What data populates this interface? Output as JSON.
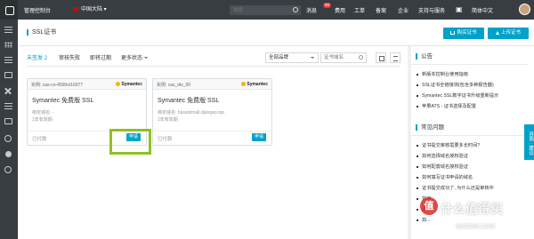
{
  "topbar": {
    "title": "管理控制台",
    "region": "中国大陆",
    "search_placeholder": "搜索",
    "nav": [
      "消息",
      "费用",
      "工单",
      "备案",
      "企业",
      "支持与服务"
    ],
    "message_badge": "88",
    "language": "简体中文"
  },
  "page": {
    "title": "SSL证书",
    "buy_button": "购买证书",
    "upload_button": "上传证书"
  },
  "tabs": [
    {
      "label": "未签发 2",
      "active": true
    },
    {
      "label": "审核失败",
      "active": false
    },
    {
      "label": "即将过期",
      "active": false
    },
    {
      "label": "更多状态",
      "active": false
    }
  ],
  "filter": {
    "brand_select": "全部品牌",
    "search_placeholder": "证书域名"
  },
  "cards": [
    {
      "instance": "实例: cas-cn-4590vt16077",
      "brand": "Symantec",
      "product": "Symantec 免费版 SSL",
      "domain": "绑定域名: -",
      "years": "1年有效期",
      "status": "已付款",
      "action": "申请"
    },
    {
      "instance": "实例: cas_idv_00",
      "brand": "Symantec",
      "product": "Symantec 免费版 SSL",
      "domain": "绑定域名: hassistmall.djangao.top",
      "years": "1年有效期",
      "status": "已付款",
      "action": "申请"
    }
  ],
  "announcements": {
    "title": "公告",
    "items": [
      "新版本控制台使用指南",
      "SSL证书全链接测(包含多种报告器)",
      "Symantec SSL数字证书升级重新提示",
      "苹果ATS - 证书选择及配置"
    ]
  },
  "faq": {
    "title": "常见问题",
    "items": [
      "证书提交审核需要多长时间?",
      "如何选择域名授权验证",
      "如何配置域名授权验证",
      "如何填写证书申请的域名",
      "证书提交成功了, 为什么还是审核中",
      "如何...",
      "证...",
      "如..."
    ]
  },
  "feedback": "咨询 · 建议",
  "watermark": {
    "badge": "值",
    "text": "什么值得买",
    "sub": "SMZDM.COM"
  },
  "colors": {
    "accent": "#00a2ca",
    "topbar": "#373d41",
    "highlight": "#8ec21f"
  }
}
